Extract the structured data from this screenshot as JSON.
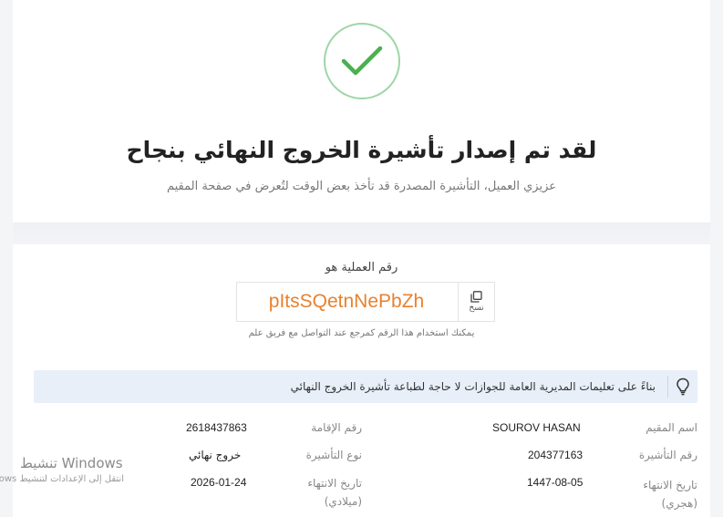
{
  "success": {
    "title": "لقد تم إصدار تأشيرة الخروج النهائي بنجاح",
    "subtitle": "عزيزي العميل، التأشيرة المصدرة قد تأخذ بعض الوقت لتُعرض في صفحة المقيم",
    "icon": "check-icon"
  },
  "operation": {
    "label": "رقم العملية هو",
    "code": "pItsSQetnNePbZh",
    "copy_label": "نسخ",
    "hint": "يمكنك استخدام هذا الرقم كمرجع عند التواصل مع فريق علم"
  },
  "notice": {
    "text": "بناءً على تعليمات المديرية العامة للجوازات لا حاجة لطباعة تأشيرة الخروج النهائي",
    "icon": "lightbulb-icon"
  },
  "details": {
    "resident_name_label": "اسم المقيم",
    "resident_name": "SOUROV HASAN",
    "iqama_label": "رقم الإقامة",
    "iqama": "2618437863",
    "visa_number_label": "رقم التأشيرة",
    "visa_number": "204377163",
    "visa_type_label": "نوع التأشيرة",
    "visa_type": "خروج نهائي",
    "expiry_hijri_label": "تاريخ الانتهاء (هجري)",
    "expiry_hijri": "1447-08-05",
    "expiry_gregorian_label": "تاريخ الانتهاء (ميلادي)",
    "expiry_gregorian": "2026-01-24"
  },
  "watermark": {
    "title": "تنشيط Windows",
    "subtitle": "انتقل إلى الإعدادات لتنشيط Windows."
  },
  "colors": {
    "accent_orange": "#e8812e",
    "success_green": "#4caf50",
    "info_bg": "#e8eff9"
  }
}
